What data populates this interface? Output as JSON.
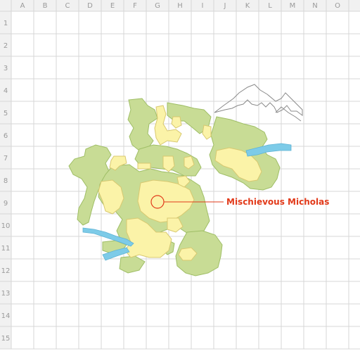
{
  "grid": {
    "columns": [
      "A",
      "B",
      "C",
      "D",
      "E",
      "F",
      "G",
      "H",
      "I",
      "J",
      "K",
      "L",
      "M",
      "N",
      "O"
    ],
    "rows": [
      "1",
      "2",
      "3",
      "4",
      "5",
      "6",
      "7",
      "8",
      "9",
      "10",
      "11",
      "12",
      "13",
      "14",
      "15"
    ]
  },
  "colors": {
    "grid_line": "#d7d7d7",
    "header_background": "#f1f1f1",
    "header_text": "#9a9a9a",
    "forest": "#c8dc95",
    "forest_edge": "#9fbe66",
    "path": "#fbf3a8",
    "path_edge": "#d8c870",
    "water": "#7dcbe8",
    "mountain": "#8a8a8a",
    "marker": "#e23a1a"
  },
  "marker": {
    "label": "Mischievous Micholas",
    "cell": "G9",
    "icon": "target-circle-icon"
  }
}
